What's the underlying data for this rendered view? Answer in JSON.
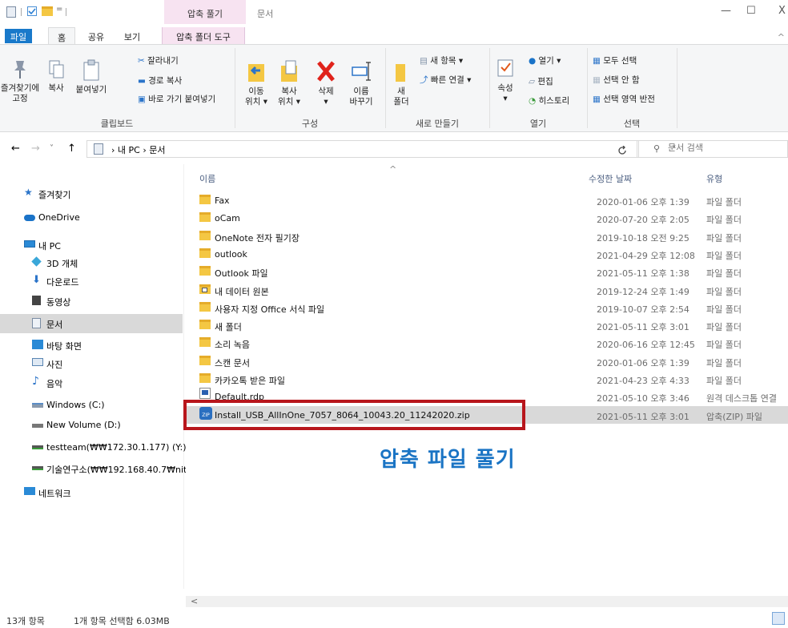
{
  "titlebar": {
    "contextual_tab": "압축 풀기",
    "title": "문서",
    "minimize": "—",
    "maximize": "☐",
    "close": "X"
  },
  "tabs": {
    "file": "파일",
    "home": "홈",
    "share": "공유",
    "view": "보기",
    "compressed_tools": "압축 폴더 도구",
    "collapse": "^"
  },
  "ribbon": {
    "clipboard": {
      "pin": [
        "즐겨찾기에",
        "고정"
      ],
      "copy": "복사",
      "paste": "붙여넣기",
      "cut": "잘라내기",
      "copy_path": "경로 복사",
      "paste_shortcut": "바로 가기 붙여넣기",
      "label": "클립보드"
    },
    "organize": {
      "move_to": [
        "이동",
        "위치 ▾"
      ],
      "copy_to": [
        "복사",
        "위치 ▾"
      ],
      "delete": [
        "삭제",
        "▾"
      ],
      "rename": [
        "이름",
        "바꾸기"
      ],
      "label": "구성"
    },
    "new": {
      "new_folder": [
        "새",
        "폴더"
      ],
      "new_item": "새 항목 ▾",
      "easy_access": "빠른 연결 ▾",
      "label": "새로 만들기"
    },
    "open": {
      "properties": [
        "속성",
        "▾"
      ],
      "open": "열기 ▾",
      "edit": "편집",
      "history": "히스토리",
      "label": "열기"
    },
    "select": {
      "select_all": "모두 선택",
      "select_none": "선택 안 함",
      "invert": "선택 영역 반전",
      "label": "선택"
    }
  },
  "address": {
    "back": "←",
    "forward": "→",
    "recent": "˅",
    "up": "↑",
    "crumbs": "› 내 PC › 문서",
    "dropdown": "˅",
    "refresh": "ὒ",
    "search_placeholder": "문서 검색"
  },
  "nav": {
    "items": [
      {
        "label": "즐겨찾기",
        "icon": "star-icon",
        "color": "#2b74c9"
      },
      {
        "label": "OneDrive",
        "icon": "cloud-icon",
        "color": "#1a73c8"
      },
      {
        "label": "내 PC",
        "icon": "pc-icon",
        "color": "#2a8ad6"
      },
      {
        "label": "3D 개체",
        "icon": "cube-icon",
        "color": "#3aa7d9"
      },
      {
        "label": "다운로드",
        "icon": "download-icon",
        "color": "#2b74c9"
      },
      {
        "label": "동영상",
        "icon": "video-icon",
        "color": "#444"
      },
      {
        "label": "문서",
        "icon": "document-icon",
        "color": "#7a8ca3"
      },
      {
        "label": "바탕 화면",
        "icon": "desktop-icon",
        "color": "#2a8ad6"
      },
      {
        "label": "사진",
        "icon": "picture-icon",
        "color": "#5a86b3"
      },
      {
        "label": "음악",
        "icon": "music-icon",
        "color": "#2b74c9"
      },
      {
        "label": "Windows (C:)",
        "icon": "drive-icon",
        "color": "#5b8ec7"
      },
      {
        "label": "New Volume (D:)",
        "icon": "drive-icon",
        "color": "#777"
      },
      {
        "label": "testteam(₩₩172.30.1.177) (Y:)",
        "icon": "network-drive-icon",
        "color": "#3a9b3a"
      },
      {
        "label": "기술연구소(₩₩192.168.40.7₩nit",
        "icon": "network-drive-icon",
        "color": "#3a9b3a"
      },
      {
        "label": "네트워크",
        "icon": "network-icon",
        "color": "#2a8ad6"
      }
    ]
  },
  "columns": {
    "name": "이름",
    "date": "수정한 날짜",
    "type": "유형"
  },
  "files": [
    {
      "name": "Fax",
      "date": "2020-01-06 오후 1:39",
      "type": "파일 폴더",
      "icon": "folder-icon"
    },
    {
      "name": "oCam",
      "date": "2020-07-20 오후 2:05",
      "type": "파일 폴더",
      "icon": "folder-icon"
    },
    {
      "name": "OneNote 전자 필기장",
      "date": "2019-10-18 오전 9:25",
      "type": "파일 폴더",
      "icon": "folder-icon"
    },
    {
      "name": "outlook",
      "date": "2021-04-29 오후 12:08",
      "type": "파일 폴더",
      "icon": "folder-icon"
    },
    {
      "name": "Outlook 파일",
      "date": "2021-05-11 오후 1:38",
      "type": "파일 폴더",
      "icon": "folder-icon"
    },
    {
      "name": "내 데이터 원본",
      "date": "2019-12-24 오후 1:49",
      "type": "파일 폴더",
      "icon": "data-source-folder-icon"
    },
    {
      "name": "사용자 지정 Office 서식 파일",
      "date": "2019-10-07 오후 2:54",
      "type": "파일 폴더",
      "icon": "folder-icon"
    },
    {
      "name": "새 폴더",
      "date": "2021-05-11 오후 3:01",
      "type": "파일 폴더",
      "icon": "folder-icon"
    },
    {
      "name": "소리 녹음",
      "date": "2020-06-16 오후 12:45",
      "type": "파일 폴더",
      "icon": "folder-icon"
    },
    {
      "name": "스캔 문서",
      "date": "2020-01-06 오후 1:39",
      "type": "파일 폴더",
      "icon": "folder-icon"
    },
    {
      "name": "카카오톡 받은 파일",
      "date": "2021-04-23 오후 4:33",
      "type": "파일 폴더",
      "icon": "folder-icon"
    },
    {
      "name": "Default.rdp",
      "date": "2021-05-10 오후 3:46",
      "type": "원격 데스크톱 연결",
      "icon": "rdp-file-icon"
    },
    {
      "name": "Install_USB_AllInOne_7057_8064_10043.20_11242020.zip",
      "date": "2021-05-11 오후 3:01",
      "type": "압축(ZIP) 파일",
      "icon": "zip-file-icon",
      "selected": true
    }
  ],
  "annotation": {
    "text": "압축 파일 풀기",
    "color": "#1a74c4",
    "box_color": "#b8161c"
  },
  "hscroll_left": "<",
  "status": {
    "count": "13개 항목",
    "selection": "1개 항목 선택함 6.03MB"
  }
}
